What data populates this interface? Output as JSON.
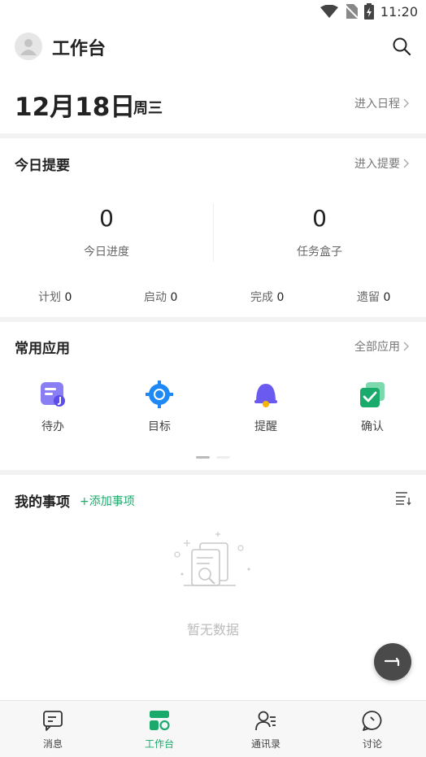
{
  "status_bar": {
    "time": "11:20"
  },
  "header": {
    "title": "工作台"
  },
  "date_bar": {
    "date": "12月18日",
    "weekday": "周三",
    "link": "进入日程"
  },
  "summary": {
    "title": "今日提要",
    "link": "进入提要",
    "progress": {
      "value": "0",
      "label": "今日进度"
    },
    "taskbox": {
      "value": "0",
      "label": "任务盒子"
    },
    "counts": [
      {
        "label": "计划",
        "value": "0"
      },
      {
        "label": "启动",
        "value": "0"
      },
      {
        "label": "完成",
        "value": "0"
      },
      {
        "label": "遗留",
        "value": "0"
      }
    ]
  },
  "apps": {
    "title": "常用应用",
    "link": "全部应用",
    "items": [
      {
        "label": "待办",
        "icon": "todo-icon"
      },
      {
        "label": "目标",
        "icon": "target-icon"
      },
      {
        "label": "提醒",
        "icon": "bell-icon"
      },
      {
        "label": "确认",
        "icon": "confirm-icon"
      }
    ]
  },
  "my_items": {
    "title": "我的事项",
    "add_label": "+添加事项",
    "empty_text": "暂无数据"
  },
  "tabbar": {
    "tabs": [
      {
        "label": "消息",
        "icon": "message-icon",
        "active": false
      },
      {
        "label": "工作台",
        "icon": "workbench-icon",
        "active": true
      },
      {
        "label": "通讯录",
        "icon": "contacts-icon",
        "active": false
      },
      {
        "label": "讨论",
        "icon": "discussion-icon",
        "active": false
      }
    ]
  },
  "colors": {
    "accent": "#1aaa6c",
    "todo": "#7b6ff0",
    "target": "#1e88f5",
    "bell": "#6a5af0",
    "confirm": "#1aaa6c"
  }
}
